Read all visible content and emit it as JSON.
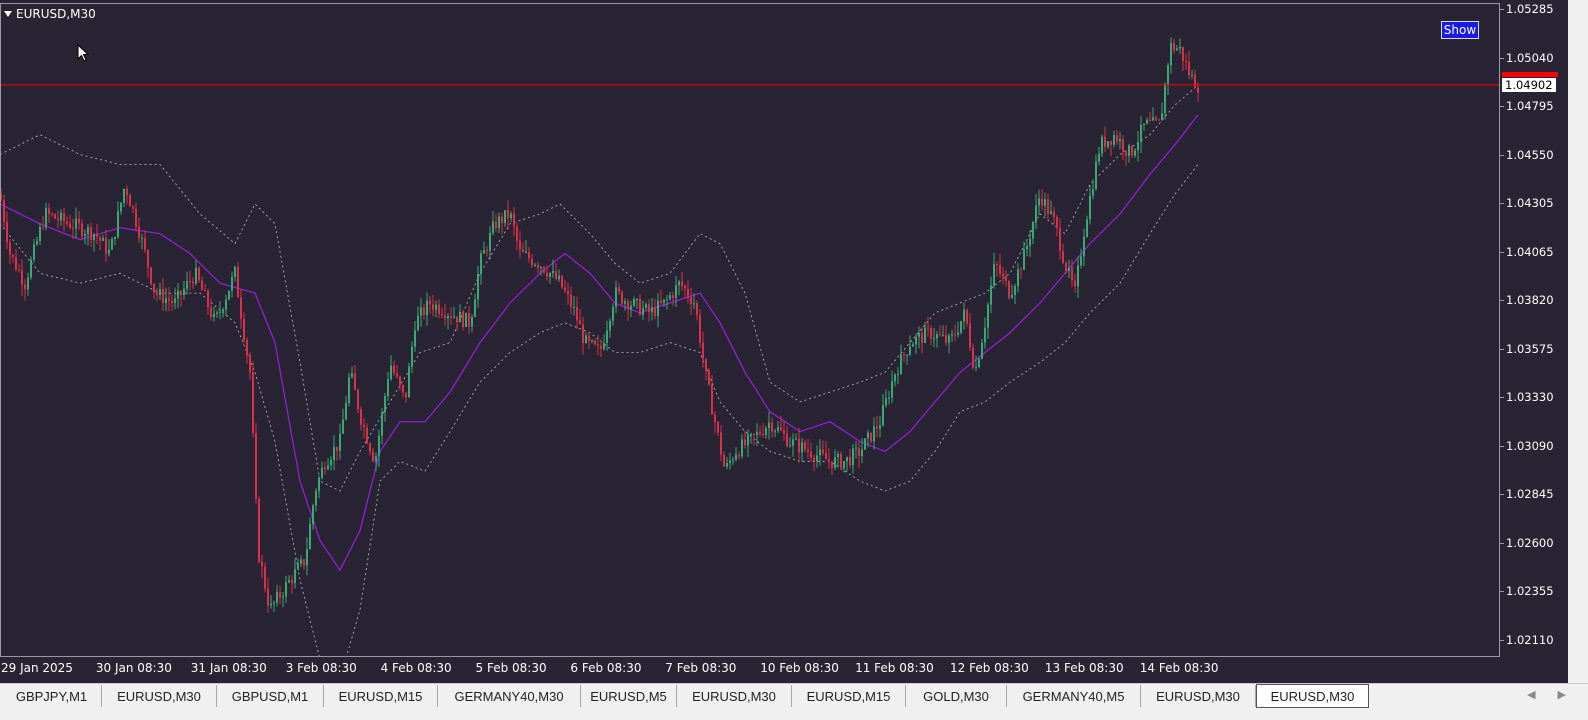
{
  "chart": {
    "title": "EURUSD,M30",
    "show_button": "Show",
    "current_price": "1.04902",
    "colors": {
      "background": "#292433",
      "bull": "#3aa873",
      "bear": "#d9314a",
      "ma": "#9a1ee0",
      "bands": "#bdbdbd",
      "price_line": "#ff0000"
    }
  },
  "price_axis": [
    "1.05285",
    "1.05040",
    "1.04795",
    "1.04550",
    "1.04305",
    "1.04065",
    "1.03820",
    "1.03575",
    "1.03330",
    "1.03090",
    "1.02845",
    "1.02600",
    "1.02355",
    "1.02110"
  ],
  "time_axis": [
    "29 Jan 2025",
    "30 Jan 08:30",
    "31 Jan 08:30",
    "3 Feb 08:30",
    "4 Feb 08:30",
    "5 Feb 08:30",
    "6 Feb 08:30",
    "7 Feb 08:30",
    "10 Feb 08:30",
    "11 Feb 08:30",
    "12 Feb 08:30",
    "13 Feb 08:30",
    "14 Feb 08:30"
  ],
  "tabs": [
    "GBPJPY,M1",
    "EURUSD,M30",
    "GBPUSD,M1",
    "EURUSD,M15",
    "GERMANY40,M30",
    "EURUSD,M5",
    "EURUSD,M30",
    "EURUSD,M15",
    "GOLD,M30",
    "GERMANY40,M5",
    "EURUSD,M30",
    "EURUSD,M30"
  ],
  "active_tab": 11,
  "chart_data": {
    "type": "candlestick",
    "ylim": [
      1.02,
      1.0535
    ],
    "current_price": 1.04902,
    "price_path": [
      [
        0,
        1.0435
      ],
      [
        10,
        1.0405
      ],
      [
        25,
        1.039
      ],
      [
        45,
        1.0425
      ],
      [
        70,
        1.042
      ],
      [
        95,
        1.0415
      ],
      [
        110,
        1.0405
      ],
      [
        125,
        1.044
      ],
      [
        140,
        1.0415
      ],
      [
        155,
        1.0385
      ],
      [
        175,
        1.038
      ],
      [
        195,
        1.0395
      ],
      [
        215,
        1.037
      ],
      [
        235,
        1.0395
      ],
      [
        250,
        1.0345
      ],
      [
        258,
        1.0255
      ],
      [
        270,
        1.0225
      ],
      [
        290,
        1.024
      ],
      [
        305,
        1.025
      ],
      [
        315,
        1.0285
      ],
      [
        325,
        1.03
      ],
      [
        340,
        1.031
      ],
      [
        350,
        1.0345
      ],
      [
        362,
        1.032
      ],
      [
        375,
        1.03
      ],
      [
        390,
        1.035
      ],
      [
        405,
        1.033
      ],
      [
        415,
        1.037
      ],
      [
        430,
        1.038
      ],
      [
        450,
        1.0375
      ],
      [
        470,
        1.037
      ],
      [
        480,
        1.04
      ],
      [
        495,
        1.042
      ],
      [
        510,
        1.0425
      ],
      [
        520,
        1.0405
      ],
      [
        540,
        1.04
      ],
      [
        560,
        1.039
      ],
      [
        575,
        1.0375
      ],
      [
        585,
        1.036
      ],
      [
        600,
        1.0355
      ],
      [
        615,
        1.0385
      ],
      [
        630,
        1.038
      ],
      [
        650,
        1.0375
      ],
      [
        665,
        1.038
      ],
      [
        680,
        1.039
      ],
      [
        695,
        1.038
      ],
      [
        705,
        1.0345
      ],
      [
        715,
        1.032
      ],
      [
        725,
        1.0295
      ],
      [
        735,
        1.0305
      ],
      [
        750,
        1.031
      ],
      [
        770,
        1.032
      ],
      [
        790,
        1.031
      ],
      [
        810,
        1.0305
      ],
      [
        830,
        1.03
      ],
      [
        845,
        1.03
      ],
      [
        860,
        1.0305
      ],
      [
        880,
        1.032
      ],
      [
        895,
        1.0345
      ],
      [
        910,
        1.036
      ],
      [
        930,
        1.0365
      ],
      [
        950,
        1.036
      ],
      [
        965,
        1.0375
      ],
      [
        975,
        1.0345
      ],
      [
        985,
        1.037
      ],
      [
        995,
        1.04
      ],
      [
        1010,
        1.0385
      ],
      [
        1025,
        1.0405
      ],
      [
        1040,
        1.0435
      ],
      [
        1055,
        1.042
      ],
      [
        1065,
        1.04
      ],
      [
        1075,
        1.0385
      ],
      [
        1085,
        1.042
      ],
      [
        1100,
        1.046
      ],
      [
        1115,
        1.0465
      ],
      [
        1130,
        1.0455
      ],
      [
        1145,
        1.047
      ],
      [
        1160,
        1.047
      ],
      [
        1170,
        1.051
      ],
      [
        1180,
        1.0508
      ],
      [
        1190,
        1.0495
      ],
      [
        1198,
        1.049
      ]
    ],
    "ma": [
      [
        0,
        1.043
      ],
      [
        40,
        1.042
      ],
      [
        80,
        1.0412
      ],
      [
        120,
        1.0418
      ],
      [
        160,
        1.0415
      ],
      [
        190,
        1.0405
      ],
      [
        220,
        1.039
      ],
      [
        255,
        1.0385
      ],
      [
        275,
        1.036
      ],
      [
        300,
        1.029
      ],
      [
        320,
        1.026
      ],
      [
        340,
        1.0245
      ],
      [
        360,
        1.0265
      ],
      [
        380,
        1.0305
      ],
      [
        400,
        1.032
      ],
      [
        425,
        1.032
      ],
      [
        450,
        1.0335
      ],
      [
        480,
        1.036
      ],
      [
        510,
        1.038
      ],
      [
        540,
        1.0395
      ],
      [
        565,
        1.0405
      ],
      [
        590,
        1.0395
      ],
      [
        615,
        1.038
      ],
      [
        640,
        1.0375
      ],
      [
        670,
        1.038
      ],
      [
        700,
        1.0385
      ],
      [
        720,
        1.037
      ],
      [
        745,
        1.0345
      ],
      [
        770,
        1.0325
      ],
      [
        800,
        1.0315
      ],
      [
        830,
        1.032
      ],
      [
        860,
        1.031
      ],
      [
        885,
        1.0305
      ],
      [
        910,
        1.0315
      ],
      [
        935,
        1.033
      ],
      [
        960,
        1.0345
      ],
      [
        985,
        1.0355
      ],
      [
        1010,
        1.0365
      ],
      [
        1040,
        1.038
      ],
      [
        1065,
        1.0395
      ],
      [
        1090,
        1.041
      ],
      [
        1120,
        1.0425
      ],
      [
        1150,
        1.0445
      ],
      [
        1175,
        1.046
      ],
      [
        1198,
        1.0475
      ]
    ],
    "upper_band": [
      [
        0,
        1.0455
      ],
      [
        40,
        1.0465
      ],
      [
        80,
        1.0455
      ],
      [
        120,
        1.045
      ],
      [
        160,
        1.045
      ],
      [
        200,
        1.0425
      ],
      [
        235,
        1.041
      ],
      [
        255,
        1.043
      ],
      [
        275,
        1.042
      ],
      [
        300,
        1.035
      ],
      [
        320,
        1.029
      ],
      [
        340,
        1.0285
      ],
      [
        360,
        1.0305
      ],
      [
        390,
        1.033
      ],
      [
        420,
        1.0355
      ],
      [
        450,
        1.036
      ],
      [
        480,
        1.0395
      ],
      [
        510,
        1.042
      ],
      [
        540,
        1.0425
      ],
      [
        560,
        1.043
      ],
      [
        590,
        1.0415
      ],
      [
        615,
        1.04
      ],
      [
        640,
        1.039
      ],
      [
        670,
        1.0395
      ],
      [
        700,
        1.0415
      ],
      [
        720,
        1.041
      ],
      [
        745,
        1.0385
      ],
      [
        770,
        1.034
      ],
      [
        800,
        1.033
      ],
      [
        830,
        1.0335
      ],
      [
        860,
        1.034
      ],
      [
        885,
        1.0345
      ],
      [
        910,
        1.036
      ],
      [
        935,
        1.0375
      ],
      [
        960,
        1.038
      ],
      [
        985,
        1.0385
      ],
      [
        1010,
        1.0395
      ],
      [
        1040,
        1.0425
      ],
      [
        1065,
        1.0415
      ],
      [
        1090,
        1.044
      ],
      [
        1120,
        1.0455
      ],
      [
        1150,
        1.0465
      ],
      [
        1175,
        1.048
      ],
      [
        1198,
        1.049
      ]
    ],
    "lower_band": [
      [
        0,
        1.042
      ],
      [
        40,
        1.0395
      ],
      [
        80,
        1.039
      ],
      [
        120,
        1.0395
      ],
      [
        160,
        1.0385
      ],
      [
        200,
        1.0385
      ],
      [
        235,
        1.037
      ],
      [
        255,
        1.0345
      ],
      [
        275,
        1.031
      ],
      [
        300,
        1.024
      ],
      [
        320,
        1.02
      ],
      [
        340,
        1.019
      ],
      [
        360,
        1.0225
      ],
      [
        380,
        1.029
      ],
      [
        400,
        1.03
      ],
      [
        425,
        1.0295
      ],
      [
        450,
        1.0315
      ],
      [
        480,
        1.034
      ],
      [
        510,
        1.0355
      ],
      [
        540,
        1.0365
      ],
      [
        565,
        1.037
      ],
      [
        590,
        1.0365
      ],
      [
        615,
        1.0355
      ],
      [
        640,
        1.0355
      ],
      [
        670,
        1.036
      ],
      [
        700,
        1.0355
      ],
      [
        720,
        1.033
      ],
      [
        745,
        1.0315
      ],
      [
        770,
        1.0305
      ],
      [
        800,
        1.03
      ],
      [
        830,
        1.03
      ],
      [
        860,
        1.029
      ],
      [
        885,
        1.0285
      ],
      [
        910,
        1.029
      ],
      [
        935,
        1.0305
      ],
      [
        960,
        1.0325
      ],
      [
        985,
        1.033
      ],
      [
        1010,
        1.034
      ],
      [
        1040,
        1.035
      ],
      [
        1065,
        1.036
      ],
      [
        1090,
        1.0375
      ],
      [
        1120,
        1.039
      ],
      [
        1150,
        1.0415
      ],
      [
        1175,
        1.0435
      ],
      [
        1198,
        1.045
      ]
    ]
  }
}
